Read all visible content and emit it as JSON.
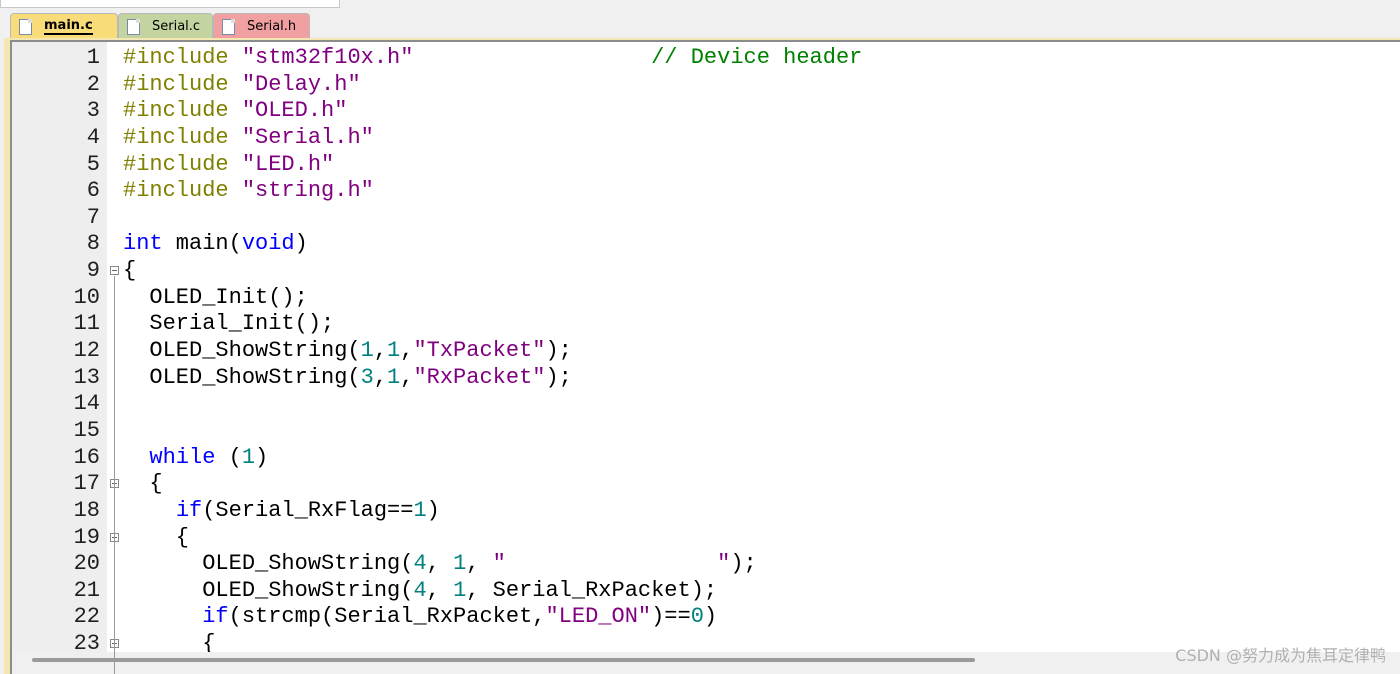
{
  "tabs": [
    {
      "label": "main.c",
      "color": "#f8dc7a",
      "active": true
    },
    {
      "label": "Serial.c",
      "color": "#c4d4a0",
      "active": false
    },
    {
      "label": "Serial.h",
      "color": "#f0a0a0",
      "active": false
    }
  ],
  "colors": {
    "preprocessor": "#808000",
    "string": "#800080",
    "keyword": "#0000ff",
    "number": "#008080",
    "comment": "#008000"
  },
  "fold_lines": [
    9,
    17,
    19,
    23
  ],
  "lines": [
    [
      [
        "pp",
        "#include "
      ],
      [
        "str",
        "\"stm32f10x.h\""
      ],
      [
        "",
        "                  "
      ],
      [
        "cm",
        "// Device header"
      ]
    ],
    [
      [
        "pp",
        "#include "
      ],
      [
        "str",
        "\"Delay.h\""
      ]
    ],
    [
      [
        "pp",
        "#include "
      ],
      [
        "str",
        "\"OLED.h\""
      ]
    ],
    [
      [
        "pp",
        "#include "
      ],
      [
        "str",
        "\"Serial.h\""
      ]
    ],
    [
      [
        "pp",
        "#include "
      ],
      [
        "str",
        "\"LED.h\""
      ]
    ],
    [
      [
        "pp",
        "#include "
      ],
      [
        "str",
        "\"string.h\""
      ]
    ],
    [],
    [
      [
        "kw",
        "int"
      ],
      [
        "",
        " main("
      ],
      [
        "kw",
        "void"
      ],
      [
        "",
        ")"
      ]
    ],
    [
      [
        "",
        "{"
      ]
    ],
    [
      [
        "",
        "  OLED_Init();"
      ]
    ],
    [
      [
        "",
        "  Serial_Init();"
      ]
    ],
    [
      [
        "",
        "  OLED_ShowString("
      ],
      [
        "num",
        "1"
      ],
      [
        "",
        ","
      ],
      [
        "num",
        "1"
      ],
      [
        "",
        ","
      ],
      [
        "str",
        "\"TxPacket\""
      ],
      [
        "",
        ");"
      ]
    ],
    [
      [
        "",
        "  OLED_ShowString("
      ],
      [
        "num",
        "3"
      ],
      [
        "",
        ","
      ],
      [
        "num",
        "1"
      ],
      [
        "",
        ","
      ],
      [
        "str",
        "\"RxPacket\""
      ],
      [
        "",
        ");"
      ]
    ],
    [],
    [],
    [
      [
        "",
        "  "
      ],
      [
        "kw",
        "while"
      ],
      [
        "",
        " ("
      ],
      [
        "num",
        "1"
      ],
      [
        "",
        ")"
      ]
    ],
    [
      [
        "",
        "  {"
      ]
    ],
    [
      [
        "",
        "    "
      ],
      [
        "kw",
        "if"
      ],
      [
        "",
        "(Serial_RxFlag=="
      ],
      [
        "num",
        "1"
      ],
      [
        "",
        ")"
      ]
    ],
    [
      [
        "",
        "    {"
      ]
    ],
    [
      [
        "",
        "      OLED_ShowString("
      ],
      [
        "num",
        "4"
      ],
      [
        "",
        ", "
      ],
      [
        "num",
        "1"
      ],
      [
        "",
        ", "
      ],
      [
        "str",
        "\"                \""
      ],
      [
        "",
        ");"
      ]
    ],
    [
      [
        "",
        "      OLED_ShowString("
      ],
      [
        "num",
        "4"
      ],
      [
        "",
        ", "
      ],
      [
        "num",
        "1"
      ],
      [
        "",
        ", Serial_RxPacket);"
      ]
    ],
    [
      [
        "",
        "      "
      ],
      [
        "kw",
        "if"
      ],
      [
        "",
        "(strcmp(Serial_RxPacket,"
      ],
      [
        "str",
        "\"LED_ON\""
      ],
      [
        "",
        ")=="
      ],
      [
        "num",
        "0"
      ],
      [
        "",
        ")"
      ]
    ],
    [
      [
        "",
        "      {"
      ]
    ]
  ],
  "watermark": "CSDN @努力成为焦耳定律鸭"
}
